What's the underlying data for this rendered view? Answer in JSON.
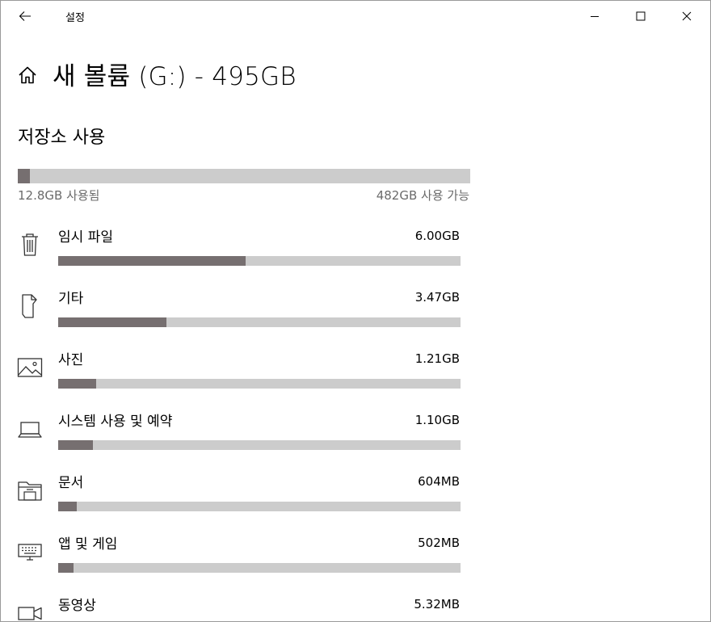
{
  "titlebar": {
    "app_title": "설정",
    "back_icon": "back-arrow-icon",
    "minimize_icon": "minimize-icon",
    "maximize_icon": "maximize-icon",
    "close_icon": "close-icon"
  },
  "header": {
    "icon": "home-icon",
    "title": "새 볼륨 (G:) - 495GB"
  },
  "storage": {
    "section_title": "저장소 사용",
    "used_fraction": 0.026,
    "used_label": "12.8GB 사용됨",
    "free_label": "482GB 사용 가능"
  },
  "categories": [
    {
      "name": "임시 파일",
      "size": "6.00GB",
      "fraction": 0.466,
      "icon": "trash-icon"
    },
    {
      "name": "기타",
      "size": "3.47GB",
      "fraction": 0.269,
      "icon": "other-files-icon"
    },
    {
      "name": "사진",
      "size": "1.21GB",
      "fraction": 0.094,
      "icon": "picture-icon"
    },
    {
      "name": "시스템 사용 및 예약",
      "size": "1.10GB",
      "fraction": 0.086,
      "icon": "laptop-icon"
    },
    {
      "name": "문서",
      "size": "604MB",
      "fraction": 0.046,
      "icon": "documents-folder-icon"
    },
    {
      "name": "앱 및 게임",
      "size": "502MB",
      "fraction": 0.038,
      "icon": "keyboard-icon"
    },
    {
      "name": "동영상",
      "size": "5.32MB",
      "fraction": 0.004,
      "icon": "video-camera-icon"
    }
  ],
  "colors": {
    "bar_fill": "#766f70",
    "bar_track": "#cccccc",
    "secondary_text": "#6b6b6b"
  }
}
